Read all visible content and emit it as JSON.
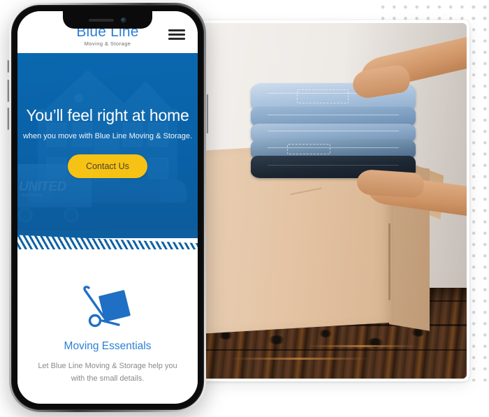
{
  "site": {
    "logo": {
      "name": "Blue Line",
      "tagline": "Moving & Storage"
    },
    "menu_icon": "hamburger-menu-icon"
  },
  "hero": {
    "title": "You’ll feel right at home",
    "subtitle": "when you move with Blue Line Moving & Storage.",
    "cta_label": "Contact Us",
    "background": "blue-tinted photo of a house with a United moving truck",
    "truck_brand": "UNITED",
    "truck_sub": "Van Lines"
  },
  "essentials": {
    "icon": "hand-truck-dolly-icon",
    "title": "Moving Essentials",
    "body": "Let Blue Line Moving & Storage help you with the small details."
  },
  "photo": {
    "alt": "Hands holding a stack of folded denim jeans above an open cardboard box on a dark rustic wood floor",
    "jeans_layers": 5
  },
  "colors": {
    "brand_blue": "#2c7fd4",
    "hero_blue": "#0d5fa0",
    "cta_yellow": "#f6c213",
    "body_gray": "#8a8a8a",
    "dot_gray": "#d6d6d6"
  }
}
